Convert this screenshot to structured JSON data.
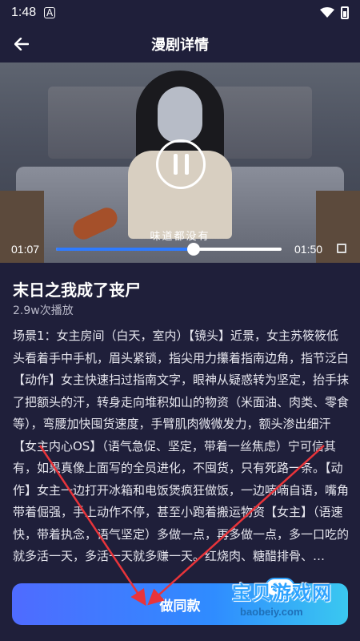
{
  "status_bar": {
    "time": "1:48",
    "notification_icon": "A"
  },
  "header": {
    "title": "漫剧详情",
    "back_icon": "arrow-left-icon"
  },
  "video": {
    "caption": "味道都没有",
    "current_time": "01:07",
    "total_time": "01:50",
    "progress": 0.61,
    "state": "playing",
    "control_icon": "pause-icon"
  },
  "drama": {
    "title": "末日之我成了丧尸",
    "play_count": "2.9w次播放",
    "description": "场景1：女主房间（白天，室内）【镜头】近景，女主苏筱筱低头看着手中手机，眉头紧锁，指尖用力攥着指南边角，指节泛白【动作】女主快速扫过指南文字，眼神从疑惑转为坚定，抬手抹了把额头的汗，转身走向堆积如山的物资（米面油、肉类、零食等），弯腰加快囤货速度，手臂肌肉微微发力，额头渗出细汗【女主内心OS】（语气急促、坚定，带着一丝焦虑）宁可信其有，如果真像上面写的全员进化，不囤货，只有死路一条。【动作】女主一边打开冰箱和电饭煲疯狂做饭，一边喃喃自语，嘴角带着倔强，手上动作不停，甚至小跑着搬运物资【女主】（语速快，带着执念，语气坚定）多做一点，再多做一点，多一口吃的就多活一天，多活一天就多赚一天。红烧肉、糖醋排骨、…"
  },
  "action": {
    "make_label": "做同款"
  },
  "watermark": {
    "title": "宝贝游戏网",
    "url": "baobeiy.com"
  },
  "colors": {
    "background": "#1f1f3a",
    "accent": "#2f7bff",
    "annotation": "#e8343a"
  }
}
